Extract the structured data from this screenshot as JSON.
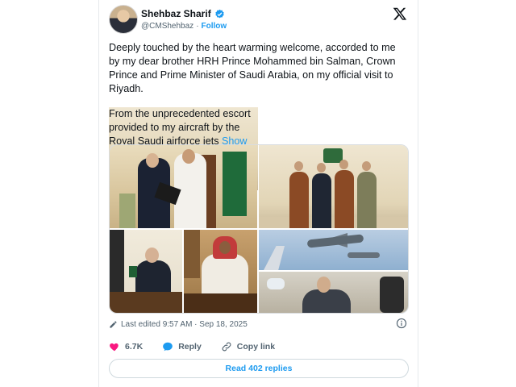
{
  "tweet": {
    "author_name": "Shehbaz Sharif",
    "handle": "@CMShehbaz",
    "separator": "·",
    "follow_label": "Follow",
    "paragraph1": "Deeply touched by the heart warming welcome, accorded to me by my dear brother HRH Prince Mohammed bin Salman, Crown Prince and Prime Minister of Saudi Arabia, on my official visit to Riyadh.",
    "paragraph2": "From the unprecedented escort provided to my aircraft by the Royal Saudi airforce jets",
    "show_more_label": "Show more",
    "edited_label": "Last edited 9:57 AM · Sep 18, 2025",
    "like_count": "6.7K",
    "reply_label": "Reply",
    "copy_link_label": "Copy link",
    "read_replies_label": "Read 402 replies"
  },
  "colors": {
    "accent": "#1d9bf0",
    "like": "#f91880",
    "secondary_text": "#536471"
  },
  "icons": {
    "verified": "verified-badge-icon",
    "brand": "x-logo-icon",
    "edit": "pencil-icon",
    "info": "info-icon",
    "like": "heart-icon",
    "reply": "speech-bubble-icon",
    "copy": "link-icon"
  }
}
